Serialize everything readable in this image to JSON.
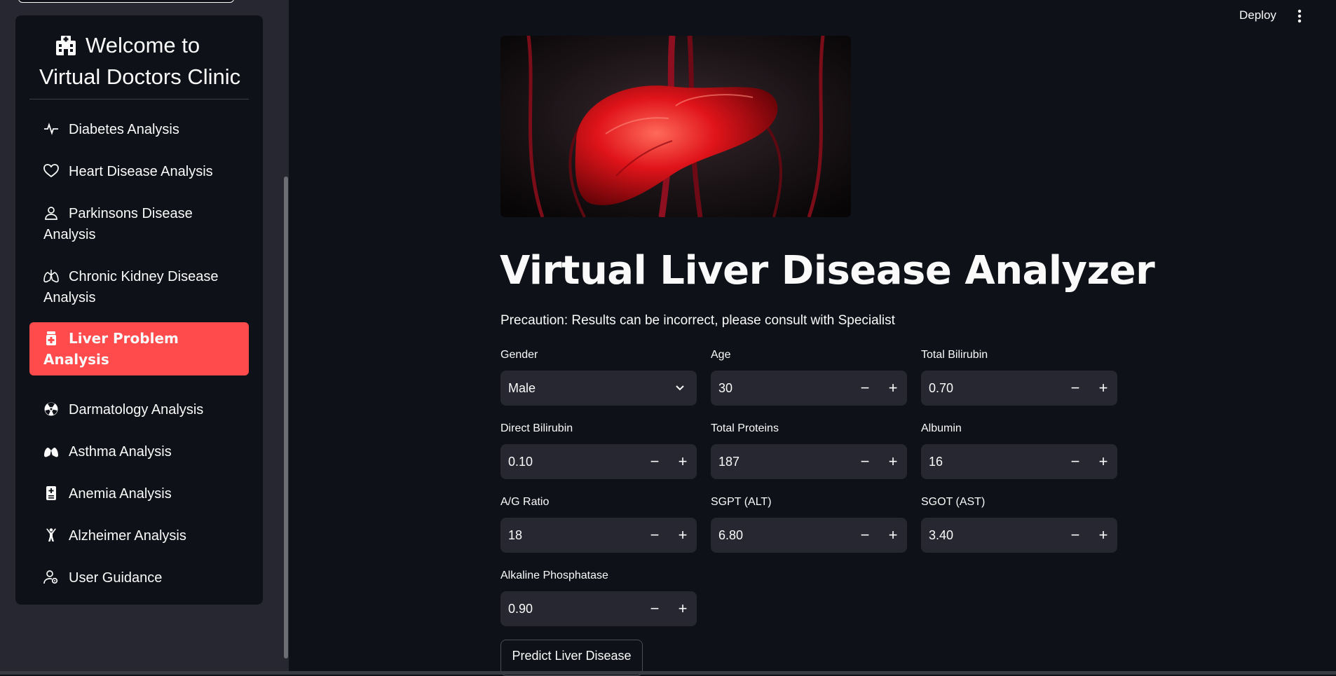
{
  "sidebar": {
    "menu_title": "Welcome to Virtual Doctors Clinic",
    "items": [
      {
        "label": "Diabetes Analysis",
        "icon": "activity-icon"
      },
      {
        "label": "Heart Disease Analysis",
        "icon": "heart-icon"
      },
      {
        "label": "Parkinsons Disease Analysis",
        "icon": "person-icon"
      },
      {
        "label": "Chronic Kidney Disease Analysis",
        "icon": "lungs-icon"
      },
      {
        "label": "Liver Problem Analysis",
        "icon": "prescription-icon",
        "active": true
      },
      {
        "label": "Darmatology Analysis",
        "icon": "radioactive-icon"
      },
      {
        "label": "Asthma Analysis",
        "icon": "lungs-fill-icon"
      },
      {
        "label": "Anemia Analysis",
        "icon": "file-medical-icon"
      },
      {
        "label": "Alzheimer Analysis",
        "icon": "person-arms-up-icon"
      },
      {
        "label": "User Guidance",
        "icon": "person-gear-icon"
      }
    ],
    "accent_color": "#ff4b4b"
  },
  "header": {
    "deploy_label": "Deploy",
    "menu_icon": "more-vertical-icon"
  },
  "main": {
    "hero_image": "liver-illustration",
    "title": "Virtual Liver Disease Analyzer",
    "precaution": "Precaution: Results can be incorrect, please consult with Specialist",
    "fields": {
      "gender": {
        "label": "Gender",
        "value": "Male"
      },
      "age": {
        "label": "Age",
        "value": "30"
      },
      "total_bilirubin": {
        "label": "Total Bilirubin",
        "value": "0.70"
      },
      "direct_bilirubin": {
        "label": "Direct Bilirubin",
        "value": "0.10"
      },
      "total_proteins": {
        "label": "Total Proteins",
        "value": "187"
      },
      "albumin": {
        "label": "Albumin",
        "value": "16"
      },
      "ag_ratio": {
        "label": "A/G Ratio",
        "value": "18"
      },
      "sgpt": {
        "label": "SGPT (ALT)",
        "value": "6.80"
      },
      "sgot": {
        "label": "SGOT (AST)",
        "value": "3.40"
      },
      "alkaline_phosphatase": {
        "label": "Alkaline Phosphatase",
        "value": "0.90"
      }
    },
    "stepper": {
      "minus": "−",
      "plus": "+"
    },
    "predict_button": "Predict Liver Disease"
  }
}
